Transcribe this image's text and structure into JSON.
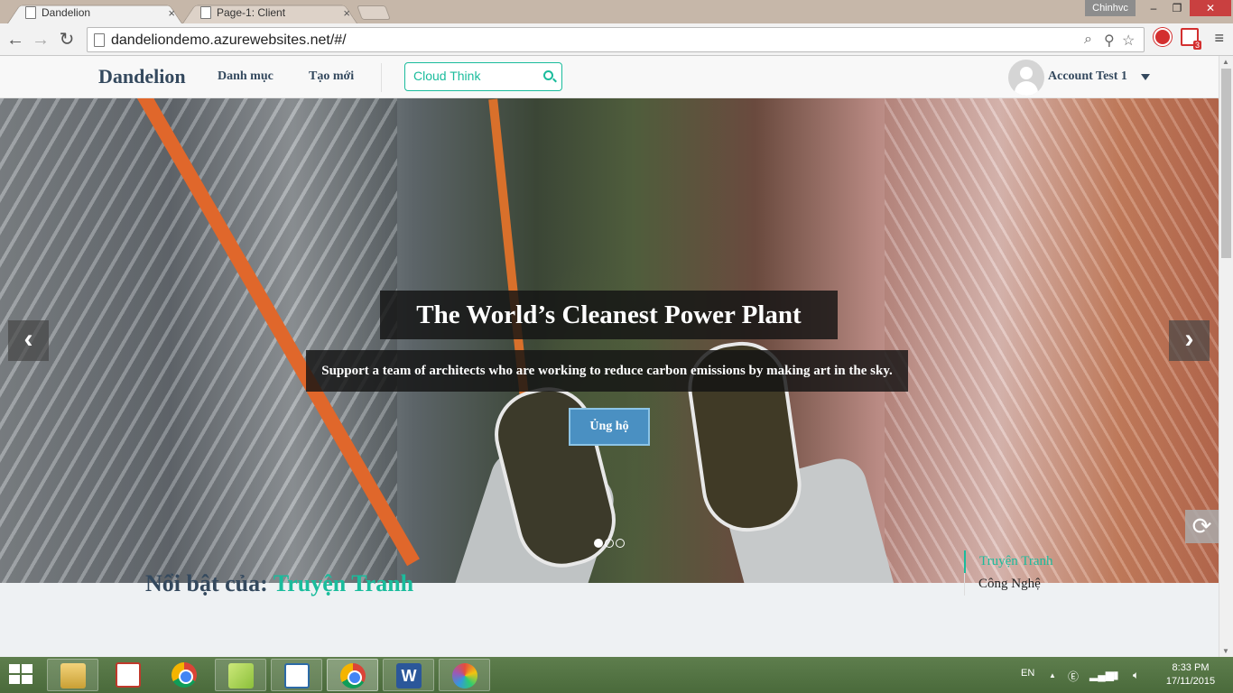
{
  "browser": {
    "tabs": [
      {
        "label": "Dandelion",
        "active": true
      },
      {
        "label": "Page-1: Client",
        "active": false
      }
    ],
    "tab_close": "×",
    "window_user": "Chinhvc",
    "window_controls": {
      "minimize": "–",
      "maximize": "❐",
      "close": "✕"
    },
    "nav": {
      "back": "←",
      "forward": "→",
      "reload": "↻"
    },
    "url": "dandeliondemo.azurewebsites.net/#/",
    "gmail_badge": "3",
    "menu": "≡"
  },
  "navbar": {
    "brand": "Dandelion",
    "links": [
      "Danh mục",
      "Tạo mới"
    ],
    "search": {
      "value": "Cloud Think",
      "placeholder": ""
    },
    "account": {
      "name": "Account Test 1"
    }
  },
  "carousel": {
    "title": "The World’s Cleanest Power Plant",
    "subtitle": "Support a team of architects who are working to reduce carbon emissions by making art in the sky.",
    "cta": "Ủng hộ",
    "prev": "‹",
    "next": "›",
    "indicator_count": 3,
    "active_index": 0,
    "refresh": "⟳"
  },
  "featured": {
    "prefix": "Nổi bật của: ",
    "category": "Truyện Tranh"
  },
  "categories": [
    {
      "label": "Truyện Tranh",
      "active": true
    },
    {
      "label": "Công Nghệ",
      "active": false
    }
  ],
  "taskbar": {
    "apps": [
      {
        "icon": "file-explorer-icon",
        "state": "open"
      },
      {
        "icon": "unikey-icon",
        "state": "closed"
      },
      {
        "icon": "chrome-icon",
        "state": "closed"
      },
      {
        "icon": "sticky-notes-icon",
        "state": "open"
      },
      {
        "icon": "reader-icon",
        "state": "open"
      },
      {
        "icon": "chrome-icon",
        "state": "active"
      },
      {
        "icon": "word-icon",
        "state": "open"
      },
      {
        "icon": "paint-icon",
        "state": "open"
      }
    ],
    "word_glyph": "W",
    "language": "EN",
    "time": "8:33 PM",
    "date": "17/11/2015"
  }
}
